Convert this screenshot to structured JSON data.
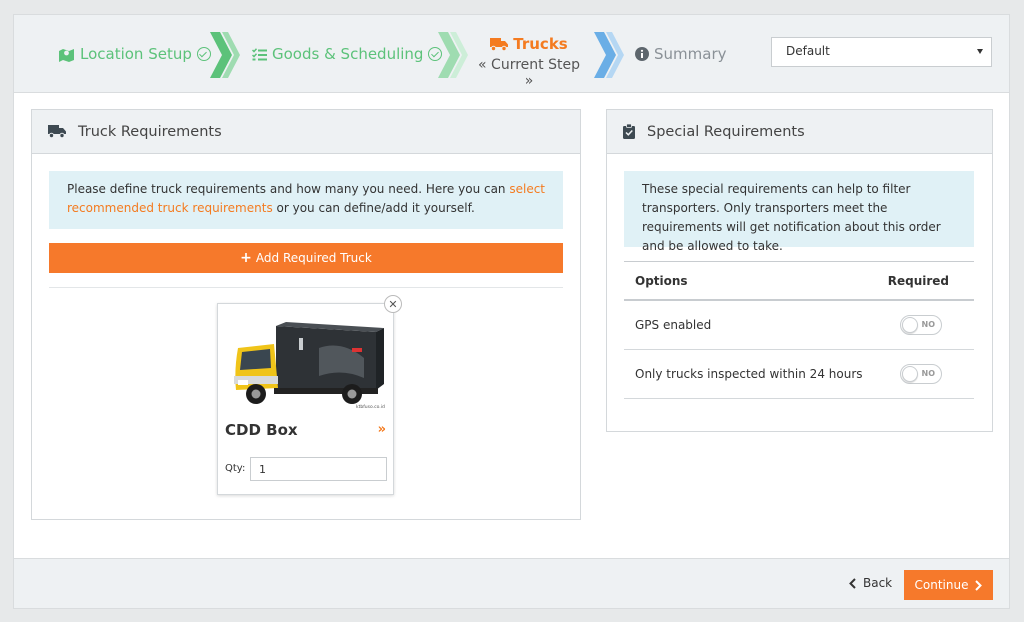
{
  "wizard": {
    "steps": [
      {
        "label": "Location Setup",
        "status": "done"
      },
      {
        "label": "Goods & Scheduling",
        "status": "done"
      },
      {
        "label": "Trucks",
        "status": "current",
        "sublabel": "« Current Step »"
      },
      {
        "label": "Summary",
        "status": "future"
      }
    ],
    "template_select": {
      "value": "Default"
    }
  },
  "truck_requirements": {
    "title": "Truck Requirements",
    "info_before": "Please define truck requirements and how many you need. Here you can ",
    "info_link": "select recommended truck requirements",
    "info_after": " or you can define/add it yourself.",
    "add_button": "Add Required Truck",
    "trucks": [
      {
        "name": "CDD Box",
        "image_caption": "ktbfuso.co.id",
        "qty_label": "Qty:",
        "qty": "1"
      }
    ]
  },
  "special_requirements": {
    "title": "Special Requirements",
    "info": "These special requirements can help to filter transporters. Only transporters meet the requirements will get notification about this order and be allowed to take.",
    "columns": [
      "Options",
      "Required"
    ],
    "rows": [
      {
        "option": "GPS enabled",
        "toggle": "NO"
      },
      {
        "option": "Only trucks inspected within 24 hours",
        "toggle": "NO"
      }
    ]
  },
  "footer": {
    "back": "Back",
    "continue": "Continue"
  },
  "colors": {
    "accent": "#f47b20",
    "done": "#5cc27a",
    "info_bg": "#e0f1f6"
  }
}
